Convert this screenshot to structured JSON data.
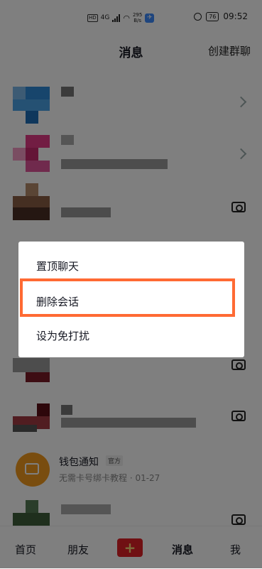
{
  "status_bar": {
    "hd": "HD",
    "net": "4G",
    "speed_value": "295",
    "speed_unit": "B/s",
    "battery": "76",
    "time": "09:52"
  },
  "header": {
    "title": "消息",
    "create_group": "创建群聊"
  },
  "wallet": {
    "name": "钱包通知",
    "badge": "官方",
    "subtitle": "无需卡号绑卡教程 · 01-27"
  },
  "context_menu": {
    "items": [
      "置顶聊天",
      "删除会话",
      "设为免打扰"
    ],
    "highlighted_item": "删除会话",
    "highlight_color": "#ff6a33"
  },
  "tabs": [
    {
      "label": "首页"
    },
    {
      "label": "朋友"
    },
    {
      "label": "消息",
      "active": true
    },
    {
      "label": "我"
    }
  ],
  "colors": {
    "brand_red": "#e02127",
    "wallet_orange": "#f39a1e"
  }
}
